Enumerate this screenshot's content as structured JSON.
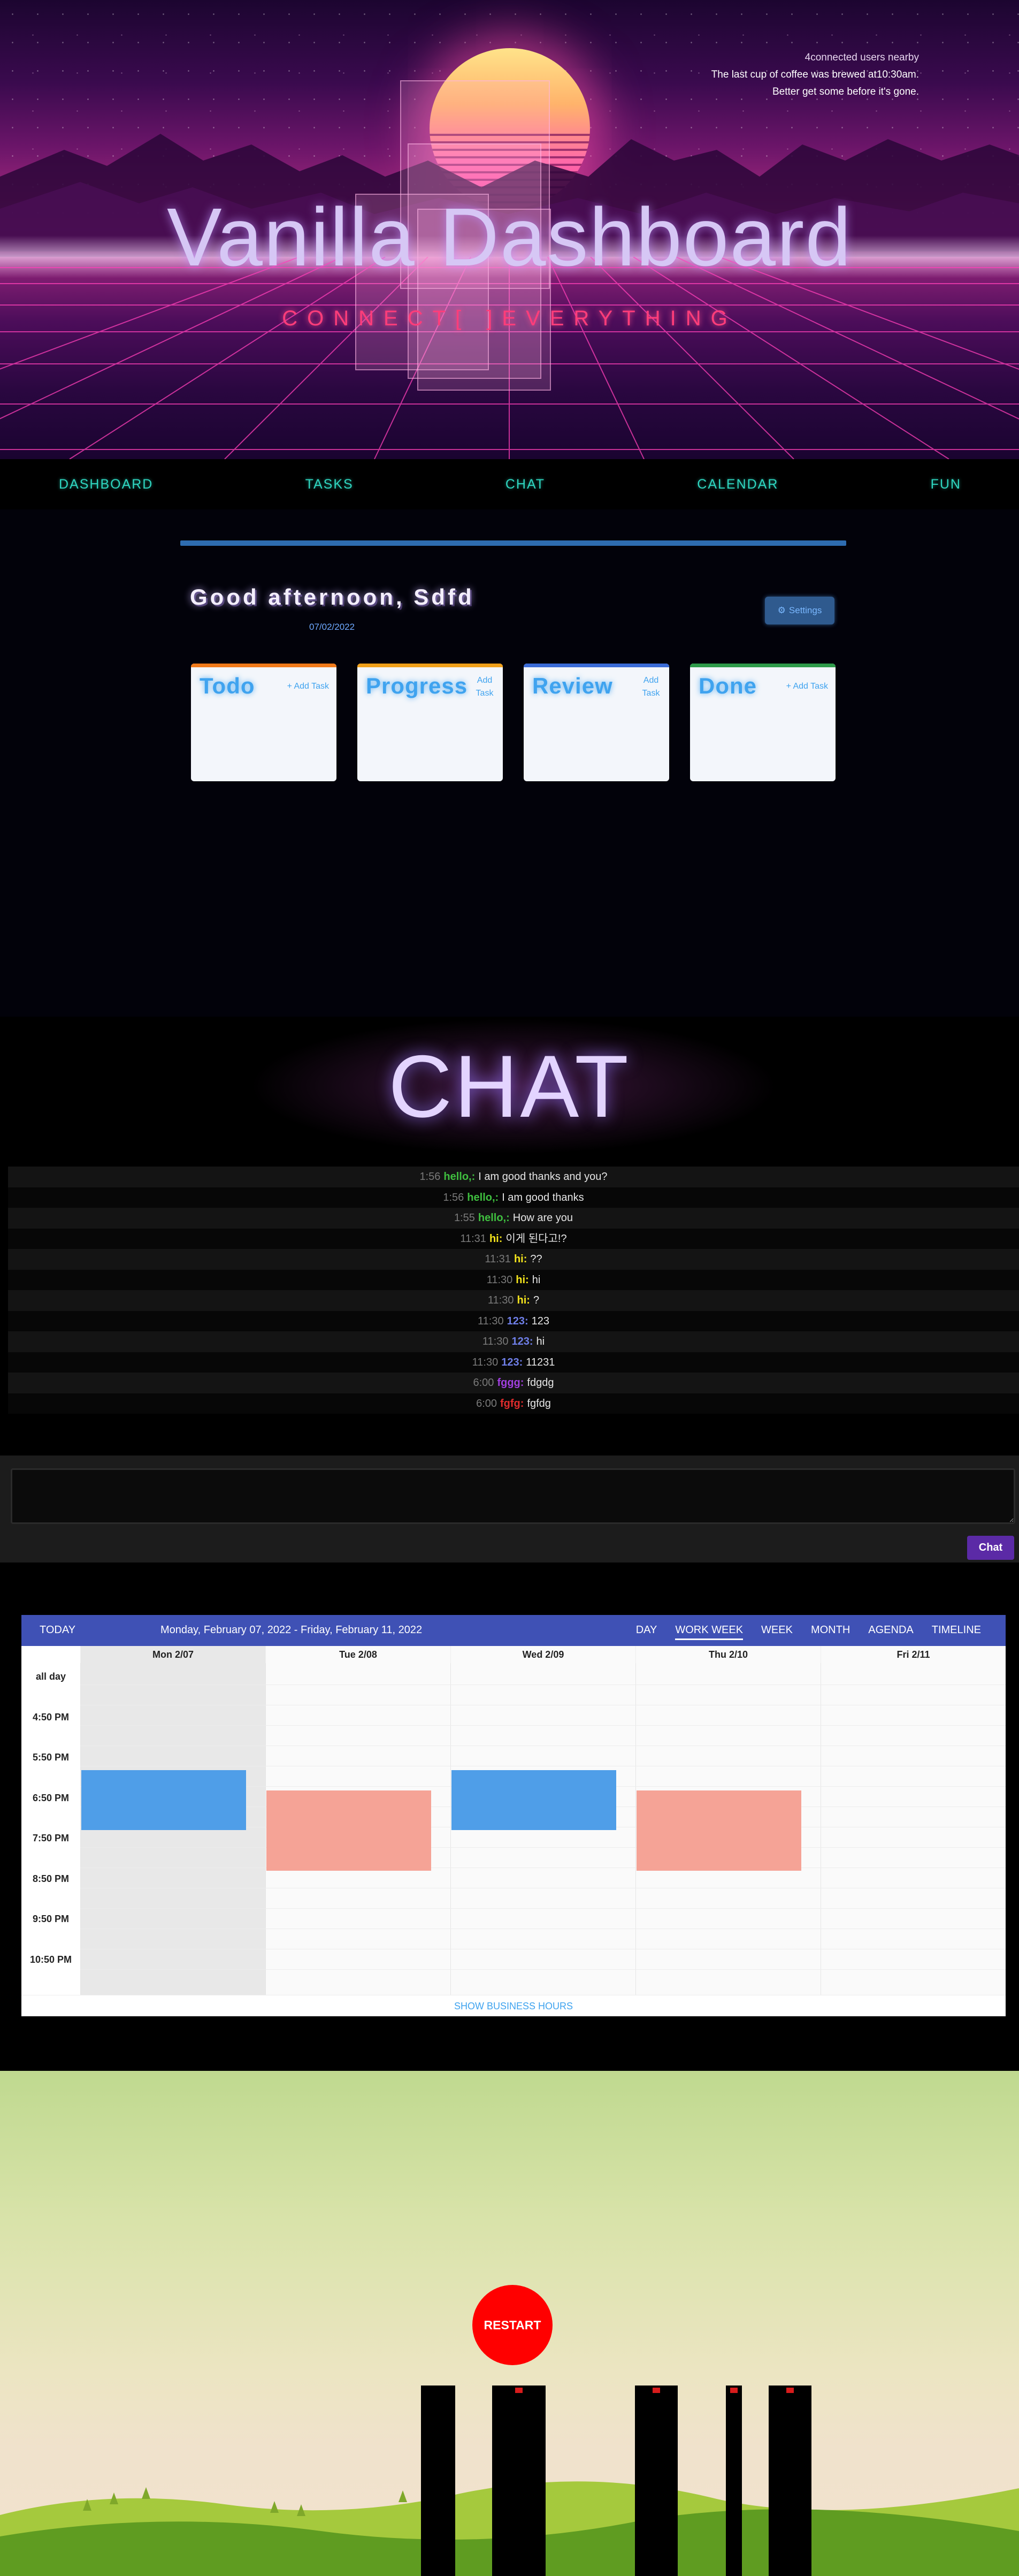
{
  "hero": {
    "title": "Vanilla Dashboard",
    "subtitle": "CONNECT[ ]EVERYTHING",
    "info_line1": "4connected users nearby",
    "info_line2": "The last cup of coffee was brewed at10:30am.",
    "info_line3": "Better get some before it's gone."
  },
  "nav": {
    "items": [
      "DASHBOARD",
      "TASKS",
      "CHAT",
      "CALENDAR",
      "FUN"
    ]
  },
  "dashboard": {
    "greeting": "Good afternoon, Sdfd",
    "date": "07/02/2022",
    "settings_label": "Settings",
    "boards": [
      {
        "title": "Todo",
        "add_label": "+ Add Task",
        "color": "#f07a1a"
      },
      {
        "title": "Progress",
        "add_label": "Add Task",
        "color": "#f0a01a"
      },
      {
        "title": "Review",
        "add_label": "Add Task",
        "color": "#3a6bd6"
      },
      {
        "title": "Done",
        "add_label": "+ Add Task",
        "color": "#2e9b4a"
      }
    ]
  },
  "chat": {
    "title": "CHAT",
    "send_label": "Chat",
    "messages": [
      {
        "time": "1:56",
        "user": "hello,:",
        "text": "I am good thanks and you?",
        "color": "#3fbf3f"
      },
      {
        "time": "1:56",
        "user": "hello,:",
        "text": "I am good thanks",
        "color": "#3fbf3f"
      },
      {
        "time": "1:55",
        "user": "hello,:",
        "text": "How are you",
        "color": "#3fbf3f"
      },
      {
        "time": "11:31",
        "user": "hi:",
        "text": "이게 된다고!?",
        "color": "#f5e51c"
      },
      {
        "time": "11:31",
        "user": "hi:",
        "text": "??",
        "color": "#f5e51c"
      },
      {
        "time": "11:30",
        "user": "hi:",
        "text": "hi",
        "color": "#f5e51c"
      },
      {
        "time": "11:30",
        "user": "hi:",
        "text": "?",
        "color": "#f5e51c"
      },
      {
        "time": "11:30",
        "user": "123:",
        "text": "123",
        "color": "#6f7fe8"
      },
      {
        "time": "11:30",
        "user": "123:",
        "text": "hi",
        "color": "#6f7fe8"
      },
      {
        "time": "11:30",
        "user": "123:",
        "text": "11231",
        "color": "#6f7fe8"
      },
      {
        "time": "6:00",
        "user": "fggg:",
        "text": "fdgdg",
        "color": "#a13fe0"
      },
      {
        "time": "6:00",
        "user": "fgfg:",
        "text": "fgfdg",
        "color": "#e02c2c"
      }
    ]
  },
  "calendar": {
    "today_label": "TODAY",
    "range": "Monday, February 07, 2022 - Friday, February 11, 2022",
    "views": [
      "DAY",
      "WORK WEEK",
      "WEEK",
      "MONTH",
      "AGENDA",
      "TIMELINE"
    ],
    "active_view": "WORK WEEK",
    "days": [
      "Mon 2/07",
      "Tue 2/08",
      "Wed 2/09",
      "Thu 2/10",
      "Fri 2/11"
    ],
    "times": [
      "all day",
      "4:50 PM",
      "5:50 PM",
      "6:50 PM",
      "7:50 PM",
      "8:50 PM",
      "9:50 PM",
      "10:50 PM"
    ],
    "footer": "SHOW BUSINESS HOURS",
    "event_colors": {
      "blue": "#4f9ee8",
      "salmon": "#f5a396"
    }
  },
  "game": {
    "restart_label": "RESTART"
  }
}
